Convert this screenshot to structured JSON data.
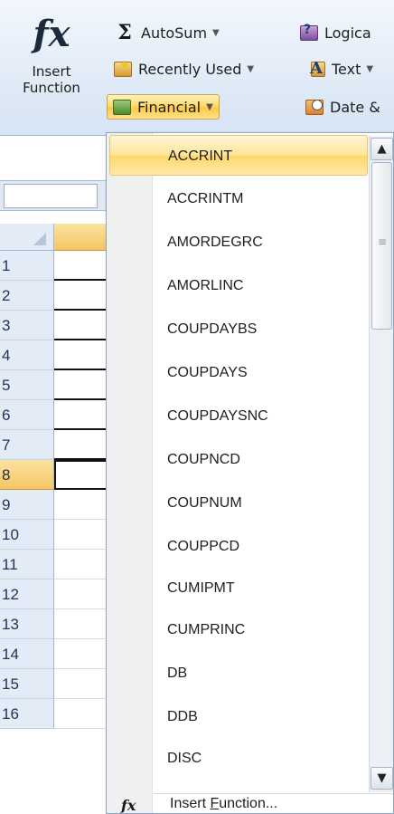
{
  "ribbon": {
    "insert_function": {
      "line1": "Insert",
      "line2": "Function",
      "icon": "fx-icon"
    },
    "autosum": {
      "label": "AutoSum",
      "icon": "sigma-icon"
    },
    "recently_used": {
      "label": "Recently Used",
      "icon": "star-book-icon"
    },
    "financial": {
      "label": "Financial",
      "icon": "financial-book-icon"
    },
    "logical": {
      "label": "Logica",
      "icon": "logical-book-icon"
    },
    "text": {
      "label": "Text",
      "icon": "text-book-icon"
    },
    "date_time": {
      "label": "Date &",
      "icon": "date-time-book-icon"
    },
    "dropdown_glyph": "▼"
  },
  "grid": {
    "rows": [
      "1",
      "2",
      "3",
      "4",
      "5",
      "6",
      "7",
      "8",
      "9",
      "10",
      "11",
      "12",
      "13",
      "14",
      "15",
      "16"
    ],
    "active_row": "8"
  },
  "menu": {
    "items": [
      "ACCRINT",
      "ACCRINTM",
      "AMORDEGRC",
      "AMORLINC",
      "COUPDAYBS",
      "COUPDAYS",
      "COUPDAYSNC",
      "COUPNCD",
      "COUPNUM",
      "COUPPCD",
      "CUMIPMT",
      "CUMPRINC",
      "DB",
      "DDB",
      "DISC"
    ],
    "highlighted": "ACCRINT",
    "footer": {
      "prefix": "Insert ",
      "accel": "F",
      "suffix": "unction...",
      "icon": "fx-icon"
    },
    "scroll_up": "▲",
    "scroll_down": "▼",
    "grip": "≡"
  }
}
